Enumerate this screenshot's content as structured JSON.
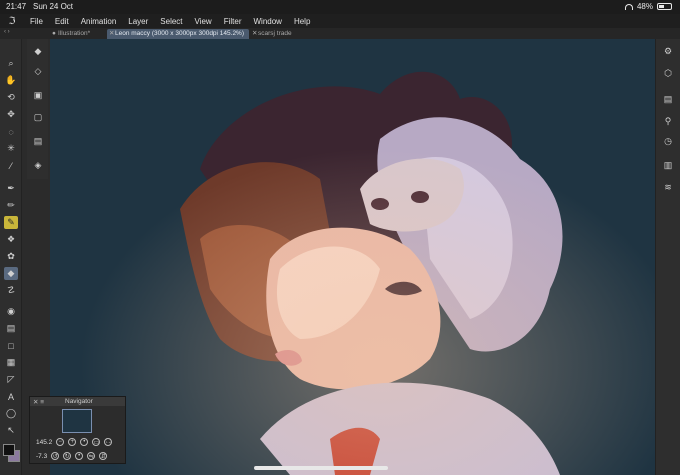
{
  "status": {
    "time": "21:47",
    "date": "Sun 24 Oct",
    "battery_label": "48%",
    "battery_level": 0.48
  },
  "menu": {
    "items": [
      "File",
      "Edit",
      "Animation",
      "Layer",
      "Select",
      "View",
      "Filter",
      "Window",
      "Help"
    ]
  },
  "tabs": [
    {
      "label": "Illustration*",
      "active": false
    },
    {
      "label": "Leon maccy  (3000 x 3000px 300dpi 145.2%)",
      "active": true
    },
    {
      "label": "scarsj trade",
      "active": false
    }
  ],
  "navigator": {
    "title": "Navigator",
    "zoom": "145.2",
    "rotation": "-7.3"
  },
  "colors": {
    "canvas_bg": "#1f3442",
    "foreground": "#111111",
    "background": "#8b7a9e",
    "accent": "#5a6a80"
  }
}
